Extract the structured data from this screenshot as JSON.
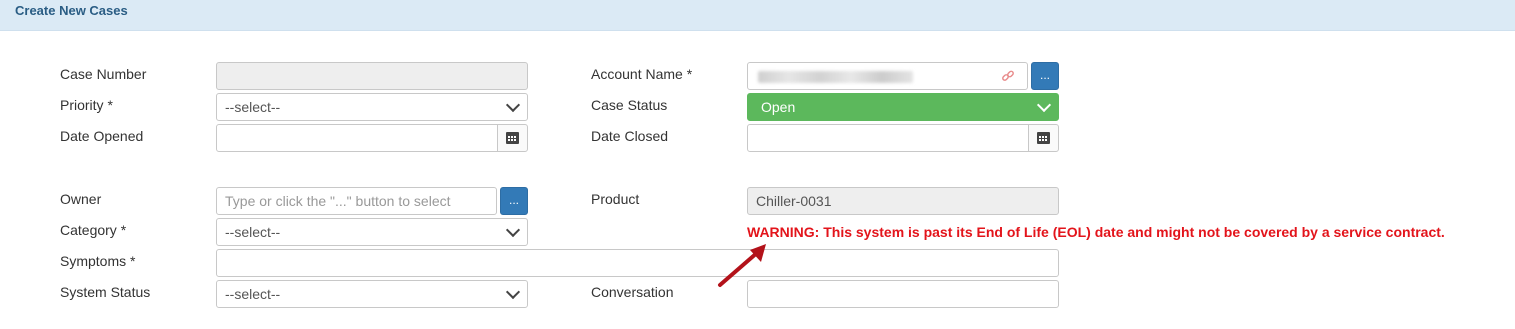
{
  "header": {
    "title": "Create New Cases"
  },
  "form": {
    "case_number": {
      "label": "Case Number",
      "value": ""
    },
    "account_name": {
      "label": "Account Name *",
      "value": "",
      "browse": "..."
    },
    "priority": {
      "label": "Priority *",
      "value": "--select--"
    },
    "case_status": {
      "label": "Case Status",
      "value": "Open",
      "color": "#5cb85c"
    },
    "date_opened": {
      "label": "Date Opened",
      "value": ""
    },
    "date_closed": {
      "label": "Date Closed",
      "value": ""
    },
    "owner": {
      "label": "Owner",
      "placeholder": "Type or click the \"...\" button to select",
      "browse": "..."
    },
    "product": {
      "label": "Product",
      "value": "Chiller-0031"
    },
    "category": {
      "label": "Category *",
      "value": "--select--"
    },
    "symptoms": {
      "label": "Symptoms *",
      "value": ""
    },
    "system_status": {
      "label": "System Status",
      "value": "--select--"
    },
    "conversation": {
      "label": "Conversation",
      "value": ""
    }
  },
  "warning": {
    "text": "WARNING: This system is past its End of Life (EOL) date and might not be covered by a service contract.",
    "color": "#e3141b"
  },
  "icons": {
    "calendar": "calendar-icon",
    "link": "broken-link-icon",
    "chevron": "chevron-down-icon",
    "arrow": "arrow-annotation-icon"
  }
}
